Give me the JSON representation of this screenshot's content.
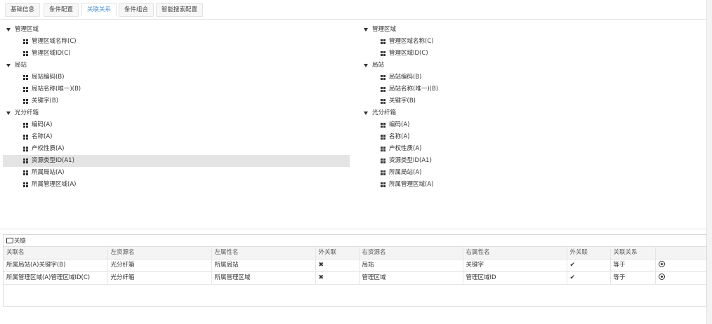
{
  "tabs": [
    {
      "label": "基础信息",
      "active": false
    },
    {
      "label": "条件配置",
      "active": false
    },
    {
      "label": "关联关系",
      "active": true
    },
    {
      "label": "条件组合",
      "active": false
    },
    {
      "label": "智能搜索配置",
      "active": false
    }
  ],
  "left_tree": {
    "groups": [
      {
        "label": "管理区域",
        "items": [
          "管理区域名称(C)",
          "管理区域ID(C)"
        ]
      },
      {
        "label": "局站",
        "items": [
          "局站编码(B)",
          "局站名称(唯一)(B)",
          "关键字(B)"
        ]
      },
      {
        "label": "光分纤箱",
        "items": [
          "编码(A)",
          "名称(A)",
          "产权性质(A)",
          "资源类型ID(A1)",
          "所属局站(A)",
          "所属管理区域(A)"
        ]
      }
    ],
    "selected": "资源类型ID(A1)"
  },
  "right_tree": {
    "groups": [
      {
        "label": "管理区域",
        "items": [
          "管理区域名称(C)",
          "管理区域ID(C)"
        ]
      },
      {
        "label": "局站",
        "items": [
          "局站编码(B)",
          "局站名称(唯一)(B)",
          "关键字(B)"
        ]
      },
      {
        "label": "光分纤箱",
        "items": [
          "编码(A)",
          "名称(A)",
          "产权性质(A)",
          "资源类型ID(A1)",
          "所属局站(A)",
          "所属管理区域(A)"
        ]
      }
    ]
  },
  "relations": {
    "title": "关联",
    "columns": [
      "关联名",
      "左资源名",
      "左属性名",
      "外关联",
      "右资源名",
      "右属性名",
      "外关联",
      "关联关系",
      ""
    ],
    "rows": [
      {
        "name": "所属局站(A)关键字(B)",
        "left_resource": "光分纤箱",
        "left_attr": "所属局站",
        "left_outer": "✖",
        "right_resource": "局站",
        "right_attr": "关键字",
        "right_outer": "✔",
        "relation": "等于"
      },
      {
        "name": "所属管理区域(A)管理区域ID(C)",
        "left_resource": "光分纤箱",
        "left_attr": "所属管理区域",
        "left_outer": "✖",
        "right_resource": "管理区域",
        "right_attr": "管理区域ID",
        "right_outer": "✔",
        "relation": "等于"
      }
    ]
  }
}
